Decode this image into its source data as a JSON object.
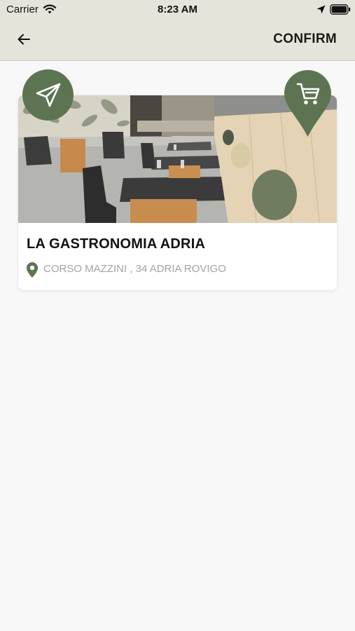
{
  "status_bar": {
    "carrier": "Carrier",
    "time": "8:23 AM"
  },
  "nav": {
    "back_icon": "arrow-left-icon",
    "confirm_label": "CONFIRM"
  },
  "restaurant": {
    "name": "LA GASTRONOMIA ADRIA",
    "address": "CORSO MAZZINI , 34 ADRIA ROVIGO",
    "image": "restaurant-interior-photo"
  },
  "actions": {
    "send_icon": "paper-plane-icon",
    "cart_icon": "shopping-cart-icon"
  },
  "colors": {
    "accent": "#5c7452",
    "topbar": "#e6e4da",
    "background": "#f8f8f8"
  }
}
